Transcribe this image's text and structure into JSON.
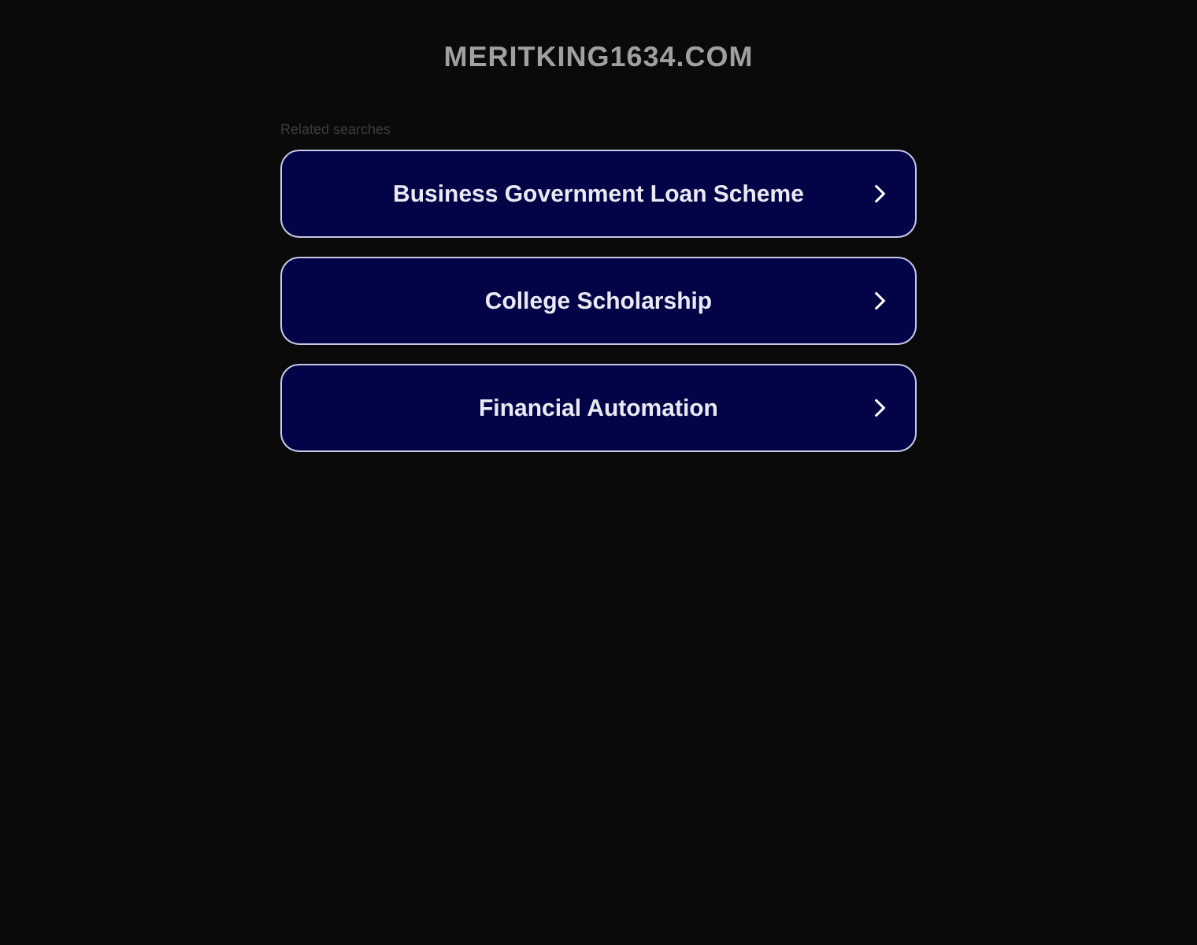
{
  "site": {
    "domain": "MERITKING1634.COM"
  },
  "related": {
    "heading": "Related searches",
    "links": [
      {
        "label": "Business Government Loan Scheme"
      },
      {
        "label": "College Scholarship"
      },
      {
        "label": "Financial Automation"
      }
    ]
  }
}
